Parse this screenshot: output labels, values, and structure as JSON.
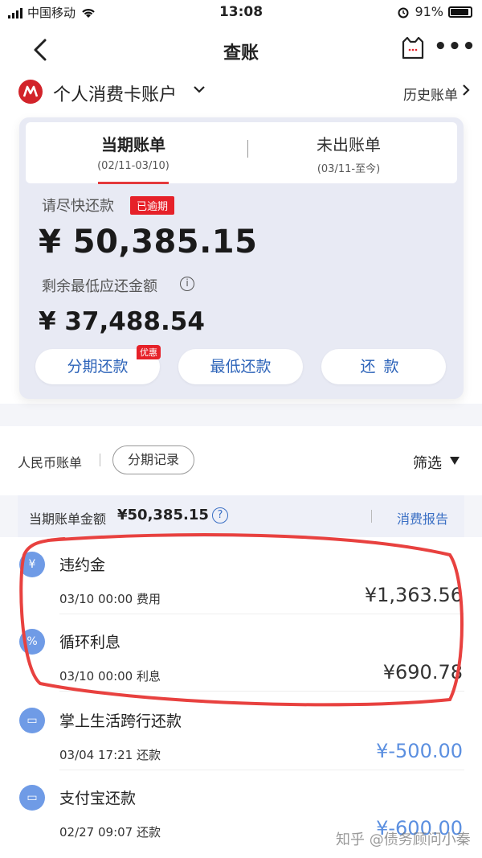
{
  "status_bar": {
    "carrier": "中国移动",
    "time": "13:08",
    "battery": "91%"
  },
  "nav": {
    "title": "查账"
  },
  "account": {
    "name": "个人消费卡账户",
    "history_link": "历史账单"
  },
  "bill": {
    "tabs": [
      {
        "label": "当期账单",
        "date": "(02/11-03/10)"
      },
      {
        "label": "未出账单",
        "date": "(03/11-至今)"
      }
    ],
    "repay_prompt": "请尽快还款",
    "overdue_badge": "已逾期",
    "amount_due": "¥ 50,385.15",
    "min_label": "剩余最低应还金额",
    "min_amount": "¥ 37,488.54",
    "buttons": {
      "installment": "分期还款",
      "min_repay": "最低还款",
      "repay": "还款"
    },
    "promo_badge": "优惠"
  },
  "filter_row": {
    "rmb_tab": "人民币账单",
    "install_record": "分期记录",
    "filter_label": "筛选"
  },
  "summary": {
    "label": "当期账单金额",
    "amount": "¥50,385.15",
    "report_link": "消费报告"
  },
  "transactions": [
    {
      "icon": "yen-icon",
      "icon_glyph": "¥",
      "title": "违约金",
      "time": "03/10 00:00  费用",
      "amount": "¥1,363.56"
    },
    {
      "icon": "percent-icon",
      "icon_glyph": "%",
      "title": "循环利息",
      "time": "03/10 00:00  利息",
      "amount": "¥690.78"
    },
    {
      "icon": "wallet-icon",
      "icon_glyph": "▭",
      "title": "掌上生活跨行还款",
      "time": "03/04 17:21  还款",
      "amount": "¥-500.00"
    },
    {
      "icon": "wallet-icon",
      "icon_glyph": "▭",
      "title": "支付宝还款",
      "time": "02/27 09:07  还款",
      "amount": "¥-600.00"
    }
  ],
  "watermark": "知乎 @债务顾问小秦",
  "colors": {
    "accent_blue": "#2e64b9",
    "overdue_red": "#e62129",
    "credit_blue": "#5b8fe0",
    "annotation_red": "#e8413f"
  }
}
